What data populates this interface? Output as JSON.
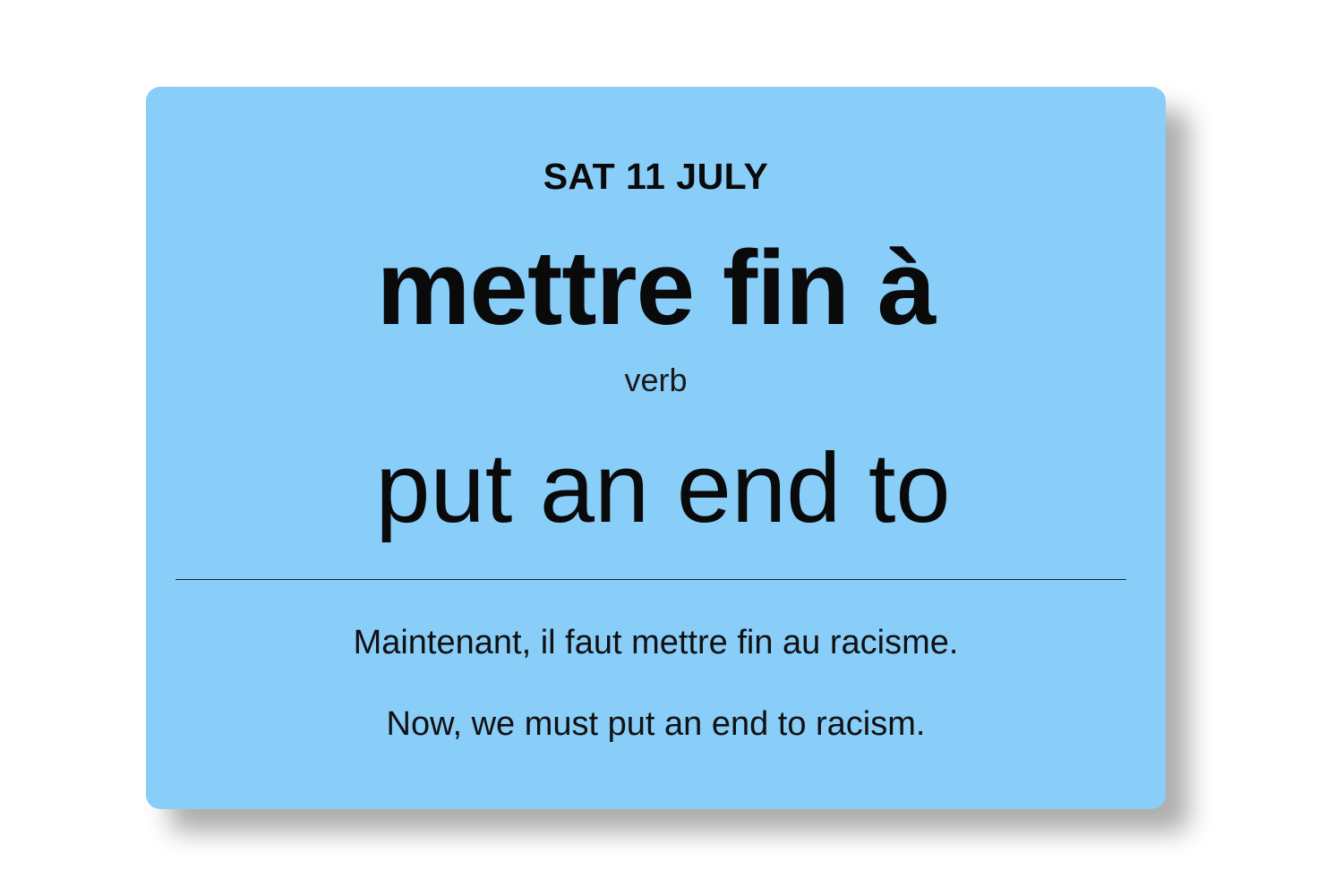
{
  "card": {
    "background_color": "#89cdf9",
    "date": "SAT 11 JULY",
    "headword": "mettre fin à",
    "part_of_speech": "verb",
    "translation": "put an end to",
    "example_sentence": "Maintenant, il faut mettre fin au racisme.",
    "example_translation": "Now, we must put an end to racism."
  }
}
